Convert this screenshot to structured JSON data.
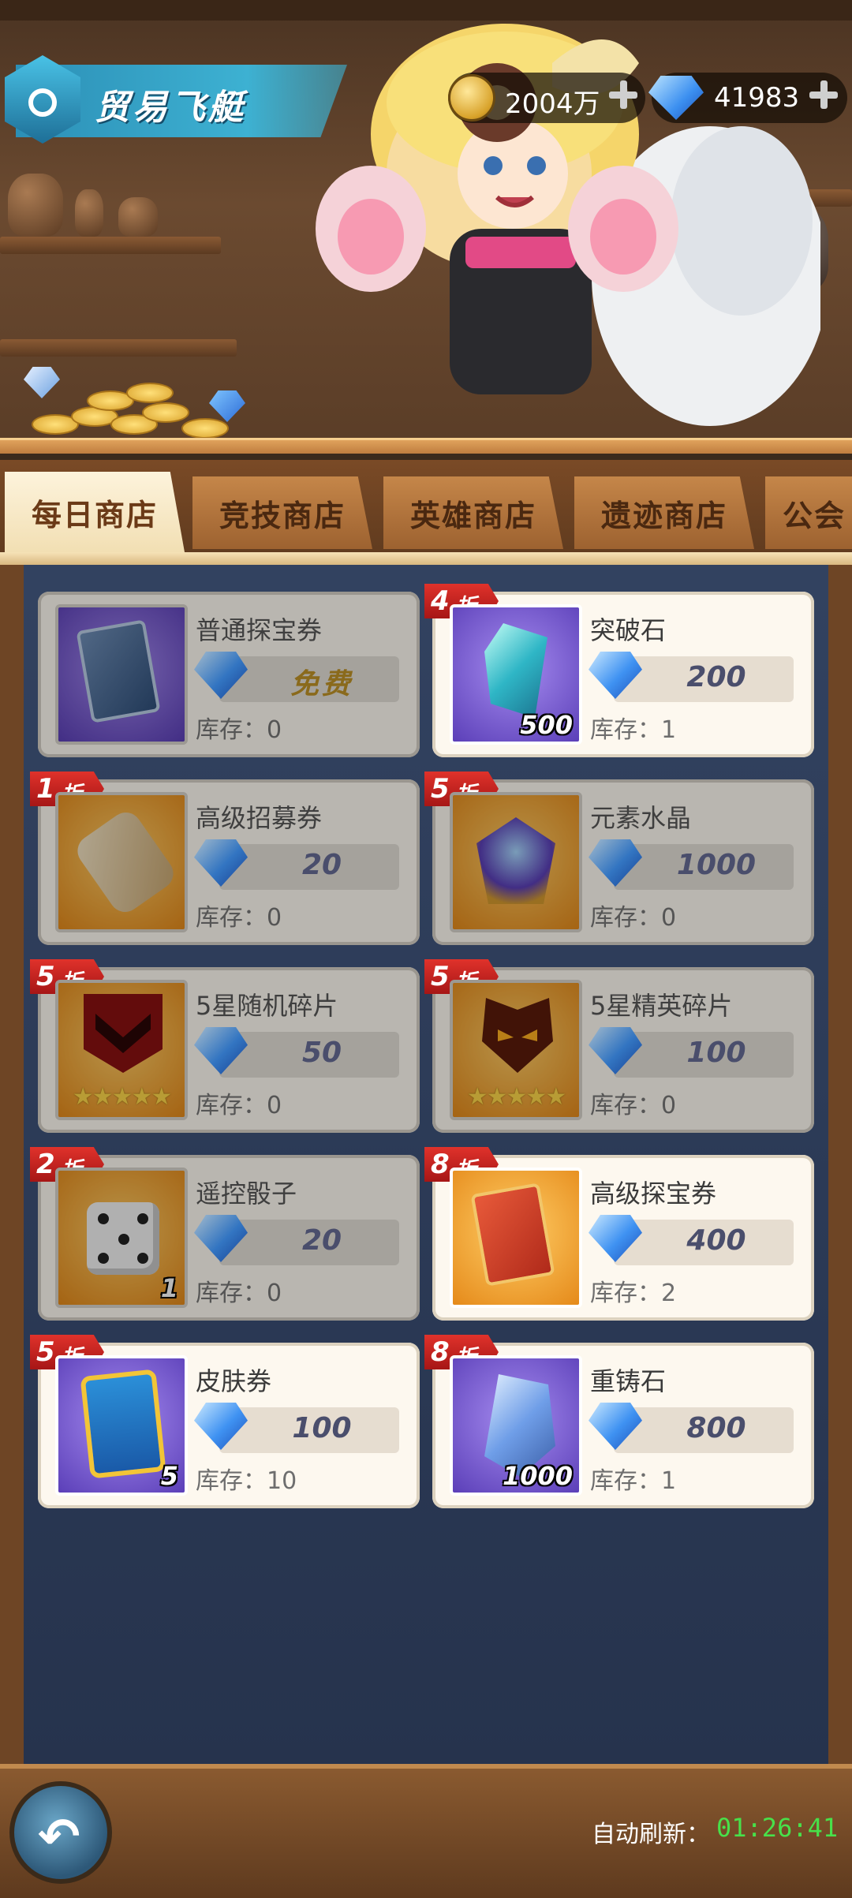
{
  "header": {
    "title": "贸易飞艇",
    "gold": "2004万",
    "diamonds": "41983"
  },
  "tabs": [
    {
      "label": "每日商店",
      "active": true
    },
    {
      "label": "竞技商店",
      "active": false
    },
    {
      "label": "英雄商店",
      "active": false
    },
    {
      "label": "遗迹商店",
      "active": false
    },
    {
      "label": "公会",
      "active": false
    }
  ],
  "items": [
    {
      "name": "普通探宝券",
      "price": "免费",
      "stock": "库存：0",
      "discount_num": "",
      "discount_suffix": "",
      "qty": "",
      "sold_out": true
    },
    {
      "name": "突破石",
      "price": "200",
      "stock": "库存：1",
      "discount_num": "4",
      "discount_suffix": "折",
      "qty": "500",
      "sold_out": false
    },
    {
      "name": "高级招募券",
      "price": "20",
      "stock": "库存：0",
      "discount_num": "1",
      "discount_suffix": "折",
      "qty": "",
      "sold_out": true
    },
    {
      "name": "元素水晶",
      "price": "1000",
      "stock": "库存：0",
      "discount_num": "5",
      "discount_suffix": "折",
      "qty": "",
      "sold_out": true
    },
    {
      "name": "5星随机碎片",
      "price": "50",
      "stock": "库存：0",
      "discount_num": "5",
      "discount_suffix": "折",
      "qty": "",
      "sold_out": true
    },
    {
      "name": "5星精英碎片",
      "price": "100",
      "stock": "库存：0",
      "discount_num": "5",
      "discount_suffix": "折",
      "qty": "",
      "sold_out": true
    },
    {
      "name": "遥控骰子",
      "price": "20",
      "stock": "库存：0",
      "discount_num": "2",
      "discount_suffix": "折",
      "qty": "1",
      "sold_out": true
    },
    {
      "name": "高级探宝券",
      "price": "400",
      "stock": "库存：2",
      "discount_num": "8",
      "discount_suffix": "折",
      "qty": "",
      "sold_out": false
    },
    {
      "name": "皮肤券",
      "price": "100",
      "stock": "库存：10",
      "discount_num": "5",
      "discount_suffix": "折",
      "qty": "5",
      "sold_out": false
    },
    {
      "name": "重铸石",
      "price": "800",
      "stock": "库存：1",
      "discount_num": "8",
      "discount_suffix": "折",
      "qty": "1000",
      "sold_out": false
    }
  ],
  "footer": {
    "refresh_label": "自动刷新：",
    "refresh_time": "01:26:41"
  },
  "icons": {
    "title": "airship-emblem-icon",
    "gold": "gold-coin-icon",
    "diamond": "diamond-icon",
    "add": "plus-icon",
    "back": "back-arrow-icon"
  }
}
